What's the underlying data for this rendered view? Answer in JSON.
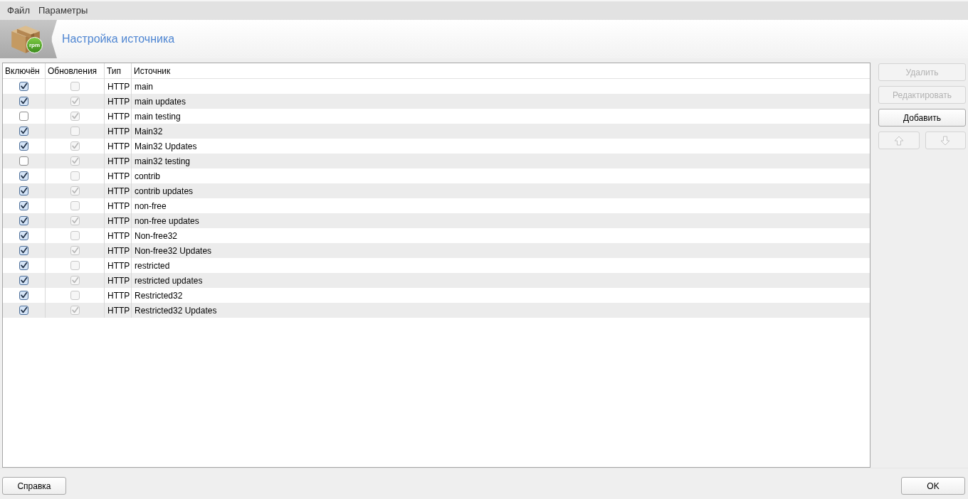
{
  "menu": [
    {
      "label": "Файл"
    },
    {
      "label": "Параметры"
    }
  ],
  "header": {
    "logo_badge": "rpm",
    "title": "Настройка источника"
  },
  "table": {
    "columns": [
      "Включён",
      "Обновления",
      "Тип",
      "Источник"
    ],
    "rows": [
      {
        "included": true,
        "updates": false,
        "updates_disabled": true,
        "type": "HTTP",
        "source": "main"
      },
      {
        "included": true,
        "updates": true,
        "updates_disabled": true,
        "type": "HTTP",
        "source": "main updates"
      },
      {
        "included": false,
        "updates": true,
        "updates_disabled": true,
        "type": "HTTP",
        "source": "main testing"
      },
      {
        "included": true,
        "updates": false,
        "updates_disabled": true,
        "type": "HTTP",
        "source": "Main32"
      },
      {
        "included": true,
        "updates": true,
        "updates_disabled": true,
        "type": "HTTP",
        "source": "Main32 Updates"
      },
      {
        "included": false,
        "updates": true,
        "updates_disabled": true,
        "type": "HTTP",
        "source": "main32 testing"
      },
      {
        "included": true,
        "updates": false,
        "updates_disabled": true,
        "type": "HTTP",
        "source": "contrib"
      },
      {
        "included": true,
        "updates": true,
        "updates_disabled": true,
        "type": "HTTP",
        "source": "contrib updates"
      },
      {
        "included": true,
        "updates": false,
        "updates_disabled": true,
        "type": "HTTP",
        "source": "non-free"
      },
      {
        "included": true,
        "updates": true,
        "updates_disabled": true,
        "type": "HTTP",
        "source": "non-free updates"
      },
      {
        "included": true,
        "updates": false,
        "updates_disabled": true,
        "type": "HTTP",
        "source": "Non-free32"
      },
      {
        "included": true,
        "updates": true,
        "updates_disabled": true,
        "type": "HTTP",
        "source": "Non-free32 Updates"
      },
      {
        "included": true,
        "updates": false,
        "updates_disabled": true,
        "type": "HTTP",
        "source": "restricted"
      },
      {
        "included": true,
        "updates": true,
        "updates_disabled": true,
        "type": "HTTP",
        "source": "restricted updates"
      },
      {
        "included": true,
        "updates": false,
        "updates_disabled": true,
        "type": "HTTP",
        "source": "Restricted32"
      },
      {
        "included": true,
        "updates": true,
        "updates_disabled": true,
        "type": "HTTP",
        "source": "Restricted32 Updates"
      }
    ]
  },
  "side_buttons": [
    {
      "label": "Удалить",
      "disabled": true
    },
    {
      "label": "Редактировать",
      "disabled": true
    },
    {
      "label": "Добавить",
      "disabled": false
    }
  ],
  "move_buttons": [
    {
      "kind": "up",
      "disabled": true
    },
    {
      "kind": "down",
      "disabled": true
    }
  ],
  "footer_buttons": [
    {
      "label": "Справка"
    },
    {
      "label": "OK"
    }
  ]
}
